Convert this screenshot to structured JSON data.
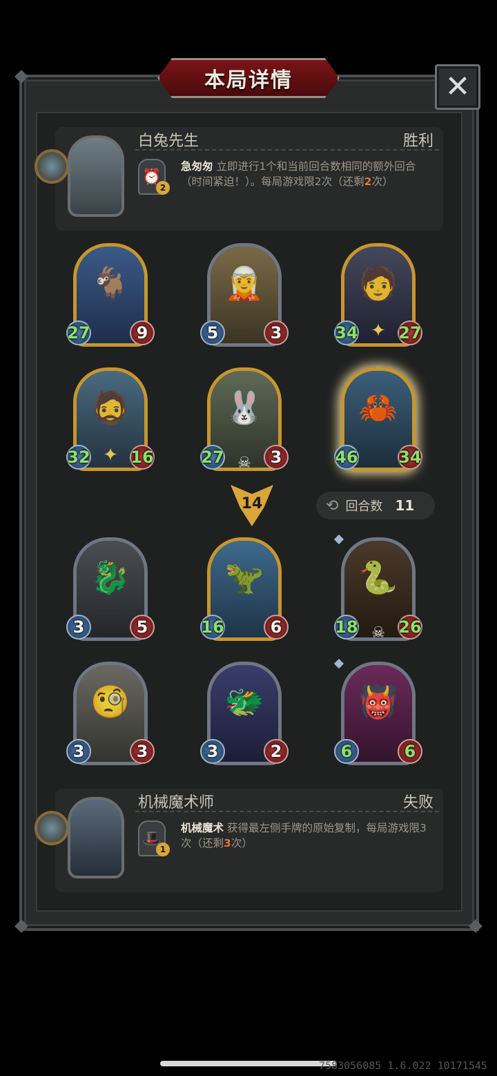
{
  "title": "本局详情",
  "close_icon": "close-icon",
  "players": {
    "top": {
      "name": "白兔先生",
      "result": "胜利",
      "skill_name": "急匆匆",
      "skill_desc_1": " 立即进行1个和当前回合数相同的额外回合（时间紧迫！）。每局游戏限",
      "skill_limit": "2",
      "skill_desc_2": "次（还剩",
      "skill_remaining": "2",
      "skill_desc_3": "次）",
      "skill_badge": "2"
    },
    "bottom": {
      "name": "机械魔术师",
      "result": "失败",
      "skill_name": "机械魔术",
      "skill_desc_1": " 获得最左侧手牌的原始复制，每局游戏限3次（还剩",
      "skill_remaining": "3",
      "skill_desc_2": "次）",
      "skill_badge": "1"
    }
  },
  "top_cards": [
    {
      "attack": "27",
      "health": "9",
      "art": "goat-wizard"
    },
    {
      "attack": "5",
      "health": "3",
      "art": "green-hair-boy"
    },
    {
      "attack": "34",
      "health": "27",
      "art": "star-boy"
    },
    {
      "attack": "32",
      "health": "16",
      "art": "dwarf"
    },
    {
      "attack": "27",
      "health": "3",
      "art": "rabbit-robot"
    },
    {
      "attack": "46",
      "health": "34",
      "art": "ice-crab"
    }
  ],
  "damage": "14",
  "round_label": "回合数",
  "round_value": "11",
  "bottom_cards": [
    {
      "attack": "3",
      "health": "5",
      "art": "grey-dragon"
    },
    {
      "attack": "16",
      "health": "6",
      "art": "blue-dragon"
    },
    {
      "attack": "18",
      "health": "26",
      "art": "serpent"
    },
    {
      "attack": "3",
      "health": "3",
      "art": "scribe"
    },
    {
      "attack": "3",
      "health": "2",
      "art": "purple-dragon"
    },
    {
      "attack": "6",
      "health": "6",
      "art": "fire-demon"
    }
  ],
  "watermark": "7583056085 1.6.022 10171545",
  "colors": {
    "gold_frame": "#c7962e",
    "silver_frame": "#6f7684",
    "buff_green": "#8ee06a",
    "banner_red": "#7a1418"
  }
}
